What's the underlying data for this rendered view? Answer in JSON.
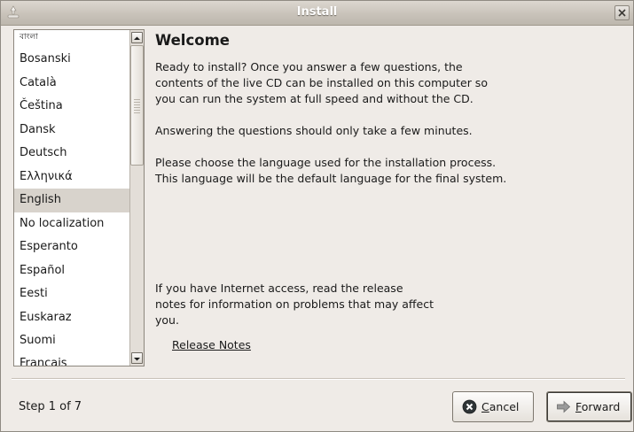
{
  "window": {
    "title": "Install"
  },
  "languages": {
    "items": [
      "বাংলা",
      "Bosanski",
      "Català",
      "Čeština",
      "Dansk",
      "Deutsch",
      "Ελληνικά",
      "English",
      "No localization",
      "Esperanto",
      "Español",
      "Eesti",
      "Euskaraz",
      "Suomi",
      "Français"
    ],
    "selected": "English"
  },
  "main": {
    "title": "Welcome",
    "intro_line1": "Ready to install? Once you answer a few questions, the",
    "intro_line2": "contents of the live CD can be installed on this computer so",
    "intro_line3": "you can run the system at full speed and without the CD.",
    "answering": "Answering the questions should only take a few minutes.",
    "choose_line1": "Please choose the language used for the installation process.",
    "choose_line2": "This language will be the default language for the final system.",
    "release_line1": "If you have Internet access, read the release",
    "release_line2": "notes for information on problems that may affect",
    "release_line3": "you.",
    "release_link": "Release Notes"
  },
  "footer": {
    "step": "Step 1 of 7",
    "cancel_label": "Cancel",
    "forward_label": "Forward"
  },
  "colors": {
    "selection": "#d8d3cc",
    "background": "#efebe7",
    "cancel_icon": "#2e3436",
    "forward_icon": "#8a8a8a"
  }
}
